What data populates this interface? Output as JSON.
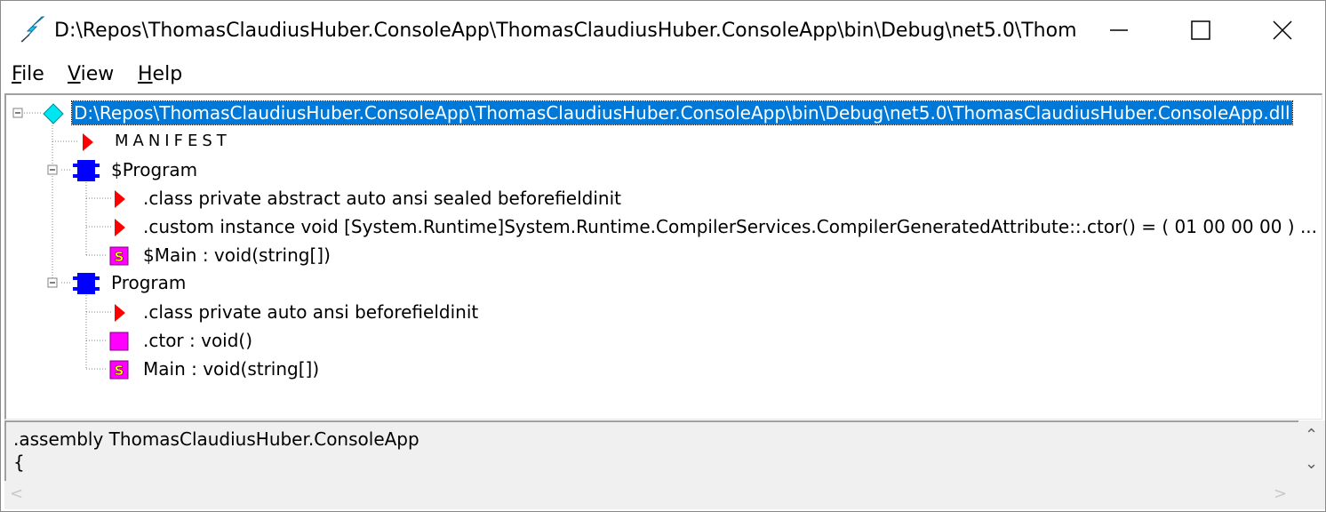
{
  "window": {
    "title": "D:\\Repos\\ThomasClaudiusHuber.ConsoleApp\\ThomasClaudiusHuber.ConsoleApp\\bin\\Debug\\net5.0\\Thom..."
  },
  "menu": {
    "file": {
      "accel": "F",
      "rest": "ile"
    },
    "view": {
      "accel": "V",
      "rest": "iew"
    },
    "help": {
      "accel": "H",
      "rest": "elp"
    }
  },
  "tree": {
    "root": "D:\\Repos\\ThomasClaudiusHuber.ConsoleApp\\ThomasClaudiusHuber.ConsoleApp\\bin\\Debug\\net5.0\\ThomasClaudiusHuber.ConsoleApp.dll",
    "manifest": "MANIFEST",
    "program1": {
      "label": "$Program",
      "class_decl": ".class private abstract auto ansi sealed beforefieldinit",
      "custom_attr": ".custom instance void [System.Runtime]System.Runtime.CompilerServices.CompilerGeneratedAttribute::.ctor() = ( 01 00 00 00 )  ...",
      "main": "$Main : void(string[])"
    },
    "program2": {
      "label": "Program",
      "class_decl": ".class private auto ansi beforefieldinit",
      "ctor": ".ctor : void()",
      "main": "Main : void(string[])"
    }
  },
  "panel": {
    "line1": ".assembly ThomasClaudiusHuber.ConsoleApp",
    "line2": "{"
  },
  "icons": {
    "app": "ildasm-lightning-icon",
    "assembly": "cyan-diamond-icon",
    "manifest": "red-triangle-icon",
    "class": "blue-class-icon",
    "static_method": "magenta-s-method-icon",
    "method": "magenta-method-icon"
  },
  "colors": {
    "selection": "#0078d7",
    "class_icon": "#0000ff",
    "method_icon": "#ff00ff",
    "manifest_icon": "#ff0000",
    "assembly_icon": "#00e0e0"
  }
}
